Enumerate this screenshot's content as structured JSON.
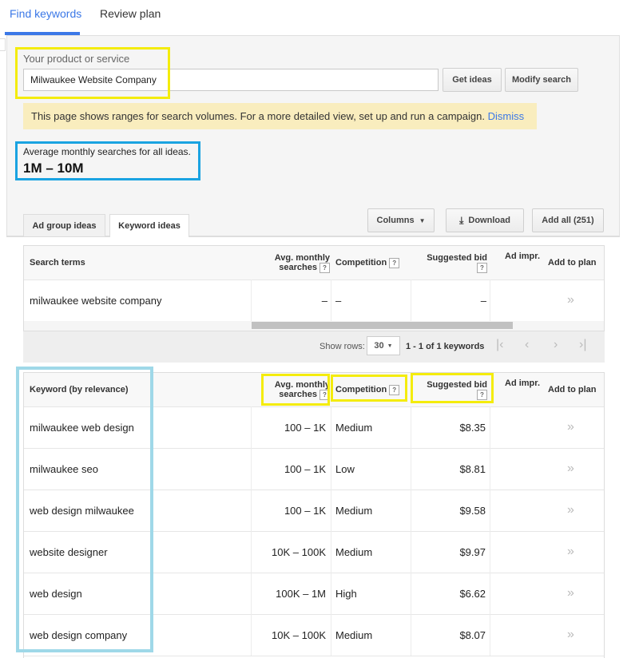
{
  "top_tabs": [
    "Find keywords",
    "Review plan"
  ],
  "product_label": "Your product or service",
  "product_value": "Milwaukee Website Company",
  "buttons": {
    "get_ideas": "Get ideas",
    "modify_search": "Modify search",
    "columns": "Columns",
    "download": "Download",
    "add_all": "Add all (251)"
  },
  "notice": {
    "text": "This page shows ranges for search volumes. For a more detailed view, set up and run a campaign.",
    "dismiss": "Dismiss"
  },
  "avg_label": "Average monthly searches for all ideas.",
  "avg_value": "1M – 10M",
  "sub_tabs": [
    "Ad group ideas",
    "Keyword ideas"
  ],
  "search_table": {
    "headers": {
      "term": "Search terms",
      "avg1": "Avg. monthly",
      "avg2": "searches",
      "competition": "Competition",
      "bid": "Suggested bid",
      "impr": "Ad impr.",
      "add": "Add to plan"
    },
    "row": {
      "term": "milwaukee website company",
      "avg": "–",
      "competition": "–",
      "bid": "–"
    }
  },
  "pager": {
    "show_rows_label": "Show rows:",
    "rows_value": "30",
    "range": "1 - 1 of 1 keywords"
  },
  "keyword_table": {
    "headers": {
      "keyword": "Keyword (by relevance)",
      "avg1": "Avg. monthly",
      "avg2": "searches",
      "competition": "Competition",
      "bid": "Suggested bid",
      "impr": "Ad impr.",
      "add": "Add to plan"
    },
    "rows": [
      {
        "keyword": "milwaukee web design",
        "avg": "100 – 1K",
        "competition": "Medium",
        "bid": "$8.35"
      },
      {
        "keyword": "milwaukee seo",
        "avg": "100 – 1K",
        "competition": "Low",
        "bid": "$8.81"
      },
      {
        "keyword": "web design milwaukee",
        "avg": "100 – 1K",
        "competition": "Medium",
        "bid": "$9.58"
      },
      {
        "keyword": "website designer",
        "avg": "10K – 100K",
        "competition": "Medium",
        "bid": "$9.97"
      },
      {
        "keyword": "web design",
        "avg": "100K – 1M",
        "competition": "High",
        "bid": "$6.62"
      },
      {
        "keyword": "web design company",
        "avg": "10K – 100K",
        "competition": "Medium",
        "bid": "$8.07"
      }
    ]
  },
  "colors": {
    "accent": "#3b78e7",
    "highlight_yellow": "#f4ec0c",
    "highlight_blue": "#1aa3e1",
    "highlight_lightblue": "#9fd8e8",
    "notice_bg": "#f9edbe"
  }
}
